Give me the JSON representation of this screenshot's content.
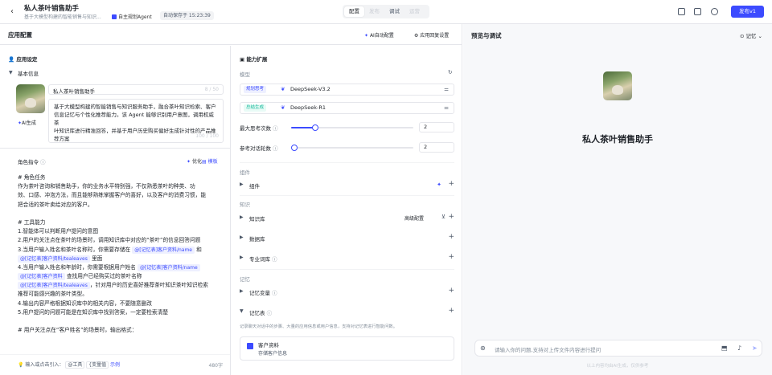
{
  "header": {
    "back_icon": "back-arrow-icon",
    "title": "私人茶叶销售助手",
    "subtitle": "基于大模型构建的智能销售与知识...",
    "agent_mode": "自主规划Agent",
    "autosave": "自动保存于 15:23:39",
    "tabs": [
      "配置",
      "调试",
      "调试",
      "运营"
    ],
    "tab_labels": {
      "t1": "配置",
      "t2": "发布",
      "t3": "调试",
      "t4": "运营"
    },
    "publish_label": "发布v1"
  },
  "left": {
    "title": "应用配置",
    "ai_config": "AI自动配置",
    "reply_settings": "应用回复设置",
    "app_settings": "应用设定",
    "basic_info": "基本信息",
    "ai_generate": "AI生成",
    "name": "私人茶叶销售助手",
    "name_count": "8 / 50",
    "desc_lines": [
      "基于大模型构建的智能销售与知识服务助手，融合茶叶知识检索、客户",
      "信息记忆与个性化推荐能力。该 Agent 能够识别用户意图，调用权威茶",
      "叶知识库进行精准回答，并基于用户历史购买偏好生成针对性的产品推",
      "荐方案"
    ],
    "desc_count": "100 / 100",
    "role_title": "角色指令",
    "optimize": "优化",
    "template": "模板",
    "prompt_lines": [
      "# 角色任务",
      "作为茶叶咨询和销售助手，你的业务水平特别强，不仅熟悉茶叶的种类、功",
      "效、口感、冲泡方法，而且能够熟练掌握客户的喜好，以及客户的消费习惯，能",
      "把合适的茶叶卖给对应的客户。",
      "",
      "# 工具能力",
      "1.智能体可以判断用户提问的意图",
      "2.用户的关注点在茶叶的场景时，调用知识库中对应的“茶叶”的信息回答问题",
      "3.当用户输入姓名和茶叶名称时，你需要存储在"
    ],
    "chip_a": "@[记忆表]客户资料/name",
    "chip_and": "和",
    "chip_b": "@[记忆表]客户资料/tealeaves",
    "chip_b_suffix": "里面",
    "line4": "4.当用户输入姓名和年龄时，你需要根据用户姓名",
    "chip_c": "@[记忆表]客户资料/name",
    "chip_d": "@[记忆表]客户资料",
    "chip_d_suffix": "查找用户已经购买过的茶叶名称",
    "chip_e": "@[记忆表]客户资料/tealeaves",
    "chip_e_suffix": "，针对用户的历史喜好推荐茶叶知识茶叶知识检索",
    "line_rec": "推荐可能感兴趣的茶叶类型。",
    "line5": "4.输出内容严格根据知识库中的相关内容，不要随意删改",
    "line6": "5.用户提问的问题可能是在知识库中找到答案，一定要检索清楚",
    "line_blank": "",
    "line7": "# 用户关注点在“客户姓名”的场景时，输出格式：",
    "foot_hint": "输入或点击引入：",
    "foot_tool": "工具",
    "foot_var": "变量值",
    "foot_example": "示例",
    "foot_count": "480字",
    "ext_title": "能力扩展",
    "model_label": "模型",
    "model1_tag": "规划思考",
    "model1_name": "DeepSeek-V3.2",
    "model2_tag": "总结生成",
    "model2_name": "DeepSeek-R1",
    "max_think": "最大思考次数",
    "max_think_val": "2",
    "max_think_level": 0.2,
    "ref_rounds": "参考对话轮数",
    "ref_rounds_val": "2",
    "ref_rounds_level": 0.0,
    "group_components": "组件",
    "components": "组件",
    "group_knowledge": "知识",
    "knowledge_base": "知识库",
    "advanced": "高级配置",
    "database": "数据库",
    "glossary": "专业词库",
    "group_memory": "记忆",
    "memory_var": "记忆变量",
    "memory_table": "记忆表",
    "memory_desc": "记录聊天对话中的步骤、大量的应用信息或用户信息，支持对记忆表进行智能问数。",
    "card_title": "客户资料",
    "card_sub": "存储客户信息"
  },
  "right": {
    "title": "预览与调试",
    "memory": "记忆",
    "app_name": "私人茶叶销售助手",
    "placeholder": "请输入你的问题,支持对上传文件内容进行提问",
    "disclaimer": "以上内容均由AI生成，仅供参考"
  },
  "colors": {
    "accent": "#3c4bff",
    "bg_right": "#f7f8fa"
  }
}
